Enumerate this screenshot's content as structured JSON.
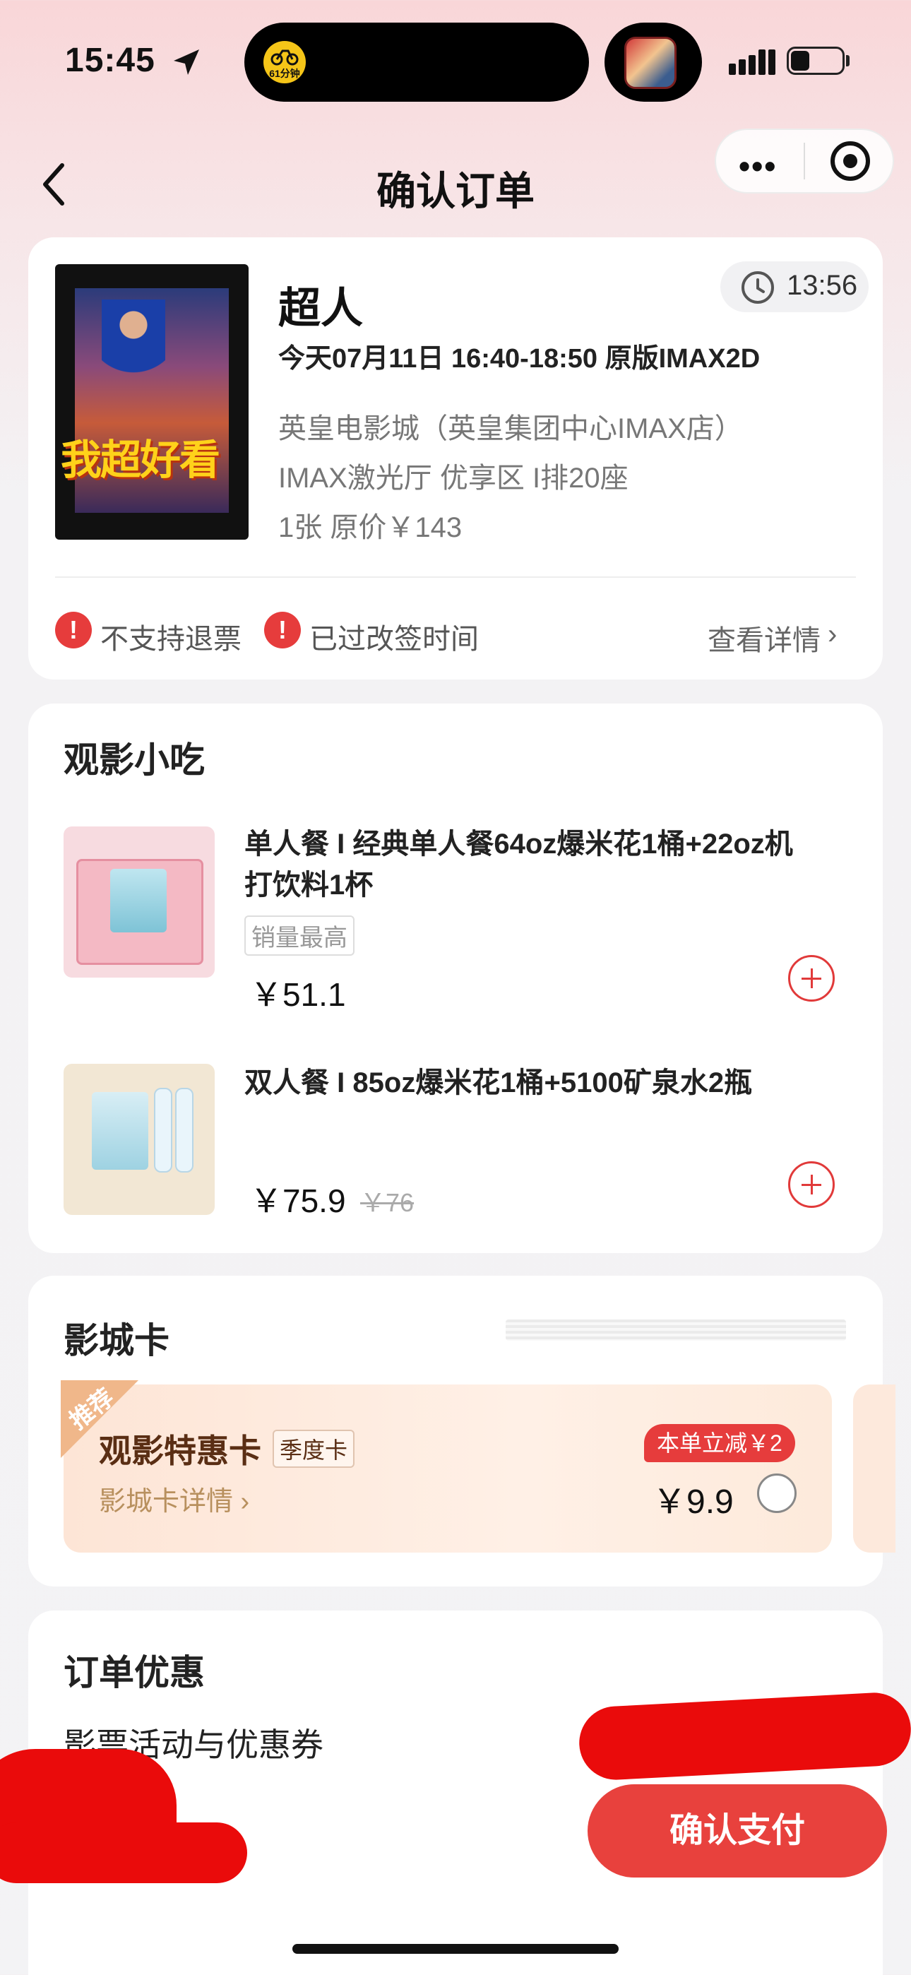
{
  "status_bar": {
    "time": "15:45",
    "island_badge": "61分钟"
  },
  "nav": {
    "title": "确认订单",
    "more": "•••"
  },
  "movie": {
    "title": "超人",
    "poster_text": "我超好看",
    "countdown": "13:56",
    "showtime": "今天07月11日 16:40-18:50 原版IMAX2D",
    "cinema": "英皇电影城（英皇集团中心IMAX店）",
    "hall": "IMAX激光厅  优享区  I排20座",
    "price_line": "1张  原价￥143",
    "notice1": "不支持退票",
    "notice2": "已过改签时间",
    "details_link": "查看详情",
    "chevron": "›"
  },
  "snacks": {
    "title": "观影小吃",
    "items": [
      {
        "name": "单人餐 I 经典单人餐64oz爆米花1桶+22oz机打饮料1杯",
        "tag": "销量最高",
        "price": "￥51.1"
      },
      {
        "name": "双人餐 I 85oz爆米花1桶+5100矿泉水2瓶",
        "price": "￥75.9",
        "original_price": "￥76"
      }
    ]
  },
  "cinema_card": {
    "title": "影城卡",
    "badge": "推荐",
    "name": "观影特惠卡",
    "period_tag": "季度卡",
    "link": "影城卡详情 ›",
    "discount": "本单立减￥2",
    "price": "￥9.9"
  },
  "order_discounts": {
    "title": "订单优惠",
    "subtitle": "影票活动与优惠券"
  },
  "bottom": {
    "pay_button": "确认支付"
  },
  "colors": {
    "accent_red": "#e8413d",
    "card_tan": "#b8905e"
  }
}
